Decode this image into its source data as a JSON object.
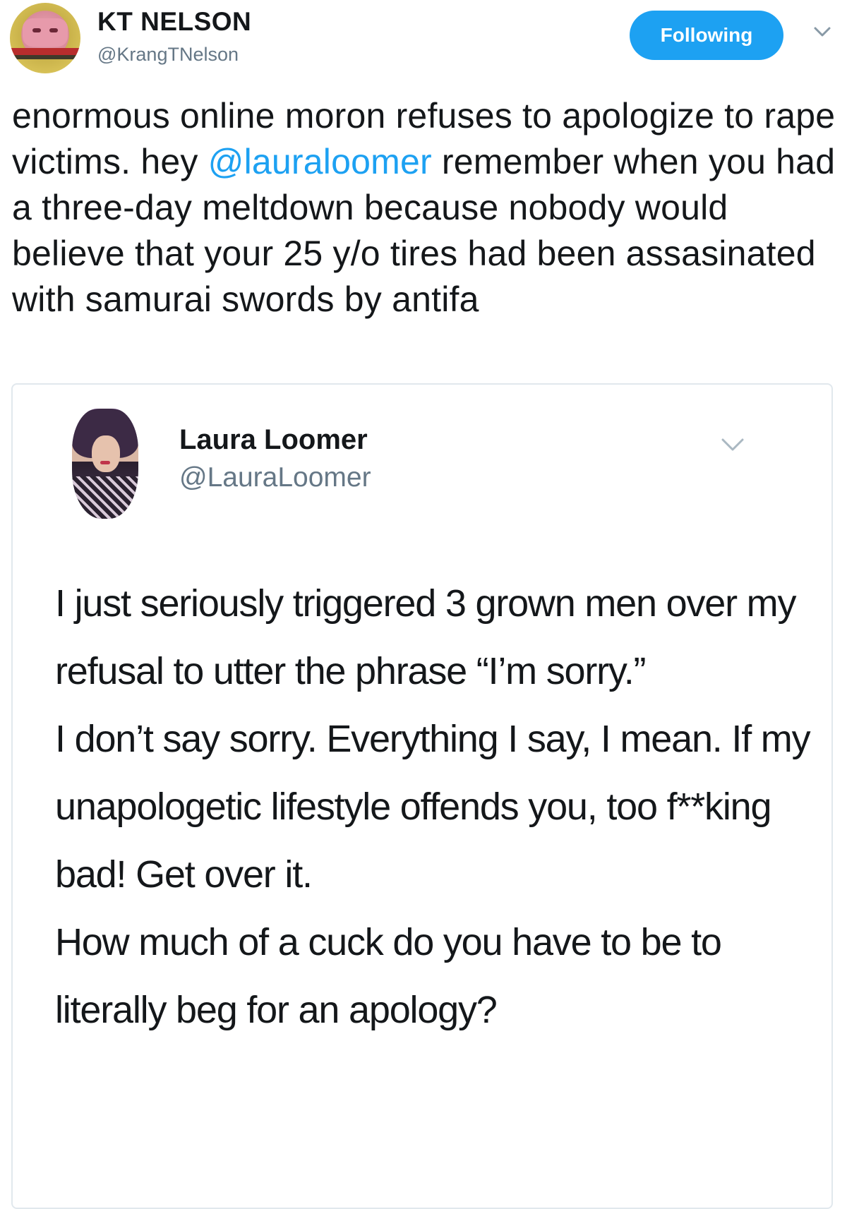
{
  "tweet": {
    "display_name": "KT NELSON",
    "handle": "@KrangTNelson",
    "follow_button_label": "Following",
    "text_before_mention": "enormous online moron refuses to apologize to rape victims. hey ",
    "mention": "@lauraloomer",
    "text_after_mention": " remember when you had a three-day meltdown because nobody would believe that your 25 y/o tires had been assasinated with samurai swords by antifa"
  },
  "quoted_tweet": {
    "display_name": "Laura Loomer",
    "handle": "@LauraLoomer",
    "paragraphs": [
      "I just seriously triggered 3 grown men over my refusal to utter the phrase “I’m sorry.”",
      "I don’t say sorry. Everything I say, I mean. If my unapologetic lifestyle offends you, too f**king bad! Get over it.",
      "How much of a cuck do you have to be to literally beg for an apology?"
    ]
  },
  "colors": {
    "accent": "#1da1f2",
    "text": "#14171a",
    "muted": "#657786",
    "border": "#e1e8ed"
  },
  "icons": [
    "avatar-krang",
    "chevron-down-icon",
    "avatar-laura",
    "chevron-down-icon"
  ]
}
